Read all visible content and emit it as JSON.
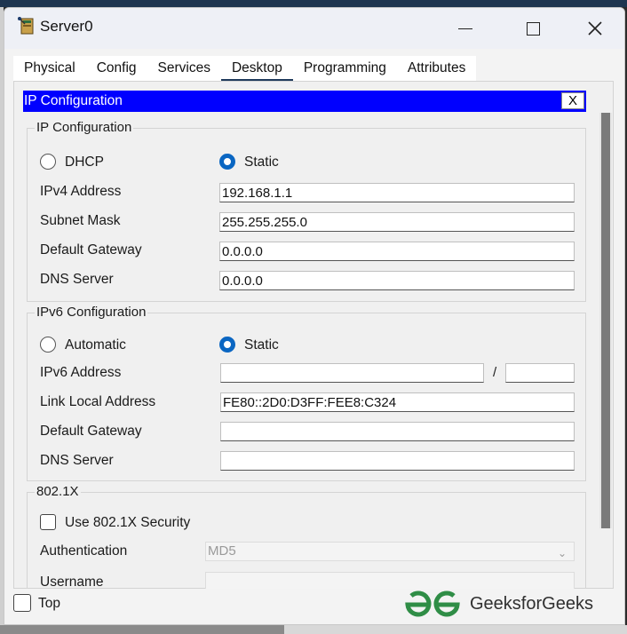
{
  "window": {
    "title": "Server0",
    "min_icon": "minimize-icon",
    "max_icon": "maximize-icon",
    "close_glyph": "✕"
  },
  "tabs": [
    {
      "label": "Physical"
    },
    {
      "label": "Config"
    },
    {
      "label": "Services"
    },
    {
      "label": "Desktop",
      "active": true
    },
    {
      "label": "Programming"
    },
    {
      "label": "Attributes"
    }
  ],
  "panel": {
    "title": "IP Configuration",
    "close_label": "X"
  },
  "ipv4": {
    "group_label": "IP Configuration",
    "dhcp_label": "DHCP",
    "static_label": "Static",
    "selected": "Static",
    "ipv4_label": "IPv4 Address",
    "ipv4_value": "192.168.1.1",
    "subnet_label": "Subnet Mask",
    "subnet_value": "255.255.255.0",
    "gateway_label": "Default Gateway",
    "gateway_value": "0.0.0.0",
    "dns_label": "DNS Server",
    "dns_value": "0.0.0.0"
  },
  "ipv6": {
    "group_label": "IPv6 Configuration",
    "auto_label": "Automatic",
    "static_label": "Static",
    "selected": "Static",
    "address_label": "IPv6 Address",
    "address_value": "",
    "slash": "/",
    "prefix_value": "",
    "link_local_label": "Link Local Address",
    "link_local_value": "FE80::2D0:D3FF:FEE8:C324",
    "gateway_label": "Default Gateway",
    "gateway_value": "",
    "dns_label": "DNS Server",
    "dns_value": ""
  },
  "dot1x": {
    "group_label": "802.1X",
    "use_label": "Use 802.1X Security",
    "checked": false,
    "auth_label": "Authentication",
    "auth_value": "MD5",
    "username_label": "Username",
    "username_value": ""
  },
  "footer": {
    "top_label": "Top",
    "top_checked": false
  },
  "watermark": {
    "text": "GeeksforGeeks",
    "color": "#2f8d46"
  },
  "colors": {
    "panel_header": "#0000ff",
    "radio_selected": "#0a66c2",
    "active_tab_underline": "#1f3a5c"
  }
}
